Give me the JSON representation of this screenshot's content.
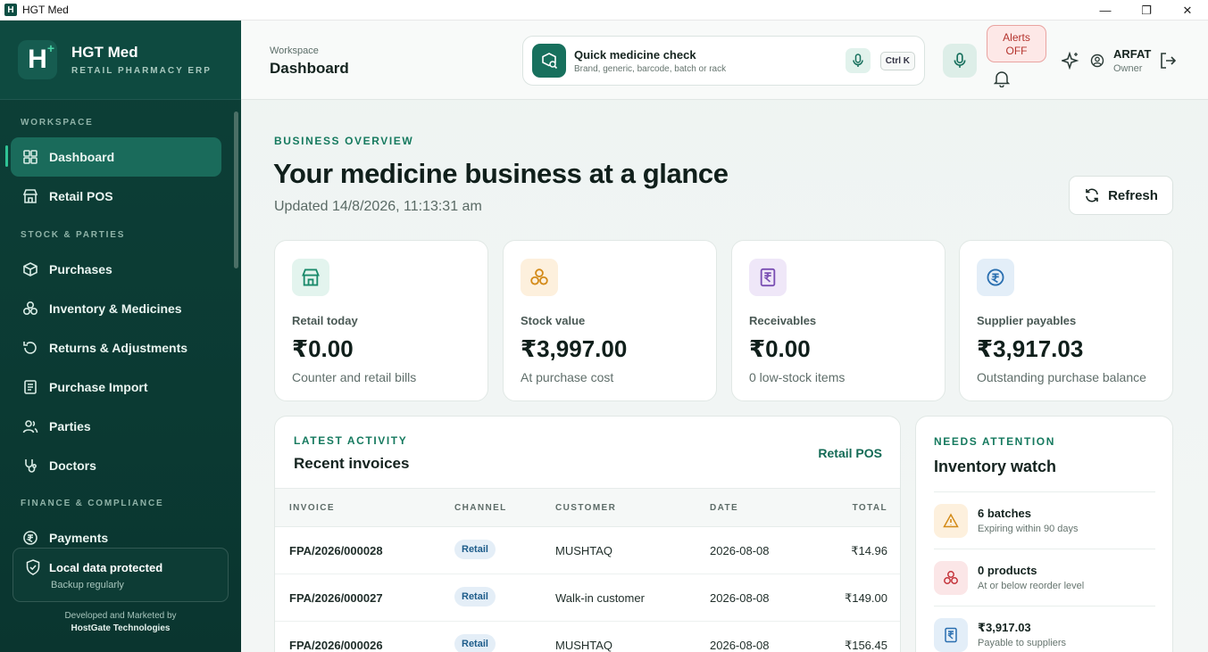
{
  "window": {
    "title": "HGT Med",
    "app_icon_letter": "H",
    "controls": [
      "—",
      "❐",
      "✕"
    ]
  },
  "brand": {
    "name": "HGT Med",
    "subtitle": "RETAIL PHARMACY ERP"
  },
  "sidebar": {
    "sections": [
      "WORKSPACE",
      "STOCK & PARTIES",
      "FINANCE & COMPLIANCE"
    ],
    "items": [
      {
        "label": "Dashboard",
        "icon": "grid-icon",
        "active": true
      },
      {
        "label": "Retail POS",
        "icon": "store-icon"
      },
      {
        "label": "Purchases",
        "icon": "box-icon"
      },
      {
        "label": "Inventory & Medicines",
        "icon": "boxes-icon"
      },
      {
        "label": "Returns & Adjustments",
        "icon": "return-icon"
      },
      {
        "label": "Purchase Import",
        "icon": "import-icon"
      },
      {
        "label": "Parties",
        "icon": "users-icon"
      },
      {
        "label": "Doctors",
        "icon": "stethoscope-icon"
      },
      {
        "label": "Payments",
        "icon": "rupee-coin-icon"
      }
    ],
    "protect": {
      "title": "Local data protected",
      "subtitle": "Backup regularly"
    },
    "credit": {
      "line1": "Developed and Marketed by",
      "line2": "HostGate Technologies"
    }
  },
  "topbar": {
    "workspace_label": "Workspace",
    "page_title": "Dashboard",
    "quick_search": {
      "title": "Quick medicine check",
      "subtitle": "Brand, generic, barcode, batch or rack",
      "shortcut": "Ctrl K"
    },
    "alerts": {
      "line1": "Alerts",
      "line2": "OFF"
    },
    "user": {
      "name": "ARFAT",
      "role": "Owner"
    }
  },
  "overview": {
    "overline": "BUSINESS OVERVIEW",
    "headline": "Your medicine business at a glance",
    "updated": "Updated 14/8/2026, 11:13:31 am",
    "refresh_label": "Refresh"
  },
  "cards": [
    {
      "label": "Retail today",
      "value": "₹0.00",
      "sub": "Counter and retail bills",
      "icon": "store-icon",
      "accent": "#1a8a6b",
      "bg": "#e3f4ee"
    },
    {
      "label": "Stock value",
      "value": "₹3,997.00",
      "sub": "At purchase cost",
      "icon": "boxes-icon",
      "accent": "#d38a18",
      "bg": "#fdf0dd"
    },
    {
      "label": "Receivables",
      "value": "₹0.00",
      "sub": "0 low-stock items",
      "icon": "receipt-icon",
      "accent": "#7a4fb3",
      "bg": "#efe7f8"
    },
    {
      "label": "Supplier payables",
      "value": "₹3,917.03",
      "sub": "Outstanding purchase balance",
      "icon": "rupee-coin-icon",
      "accent": "#2a6fb0",
      "bg": "#e3eef8"
    }
  ],
  "recent": {
    "overline": "LATEST ACTIVITY",
    "title": "Recent invoices",
    "link": "Retail POS",
    "columns": [
      "INVOICE",
      "CHANNEL",
      "CUSTOMER",
      "DATE",
      "TOTAL"
    ],
    "rows": [
      {
        "invoice": "FPA/2026/000028",
        "channel": "Retail",
        "customer": "MUSHTAQ",
        "date": "2026-08-08",
        "total": "₹14.96"
      },
      {
        "invoice": "FPA/2026/000027",
        "channel": "Retail",
        "customer": "Walk-in customer",
        "date": "2026-08-08",
        "total": "₹149.00"
      },
      {
        "invoice": "FPA/2026/000026",
        "channel": "Retail",
        "customer": "MUSHTAQ",
        "date": "2026-08-08",
        "total": "₹156.45"
      }
    ]
  },
  "watch": {
    "overline": "NEEDS ATTENTION",
    "title": "Inventory watch",
    "items": [
      {
        "title": "6 batches",
        "sub": "Expiring within 90 days",
        "icon": "warning-icon",
        "accent": "#d38a18",
        "bg": "#fdf0dd"
      },
      {
        "title": "0 products",
        "sub": "At or below reorder level",
        "icon": "boxes-icon",
        "accent": "#c4333a",
        "bg": "#fbe6e7"
      },
      {
        "title": "₹3,917.03",
        "sub": "Payable to suppliers",
        "icon": "receipt-icon",
        "accent": "#2a6fb0",
        "bg": "#e3eef8"
      }
    ]
  }
}
